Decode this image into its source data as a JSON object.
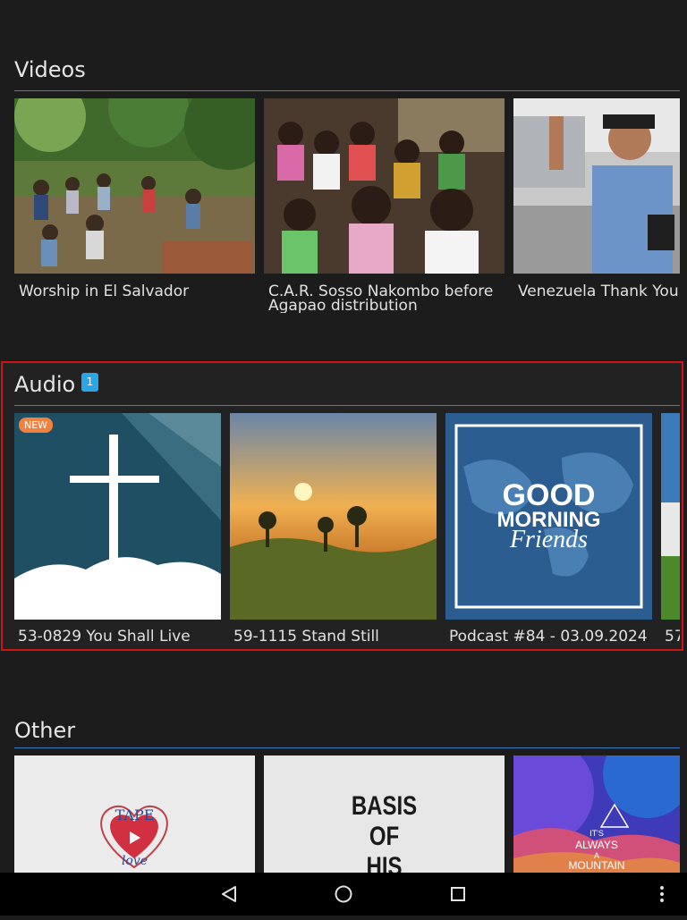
{
  "videos": {
    "title": "Videos",
    "items": [
      {
        "caption": "Worship in El Salvador"
      },
      {
        "caption": "C.A.R. Sosso Nakombo before Agapao distribution"
      },
      {
        "caption": "Venezuela Thank You"
      }
    ]
  },
  "audio": {
    "title": "Audio",
    "badge_count": "1",
    "items": [
      {
        "caption": "53-0829 You Shall Live",
        "tag": "NEW"
      },
      {
        "caption": "59-1115 Stand Still"
      },
      {
        "caption": "Podcast #84 - 03.09.2024",
        "art_line1": "GOOD",
        "art_line2": "MORNING",
        "art_line3": "Friends"
      },
      {
        "caption": "57"
      }
    ]
  },
  "other": {
    "title": "Other",
    "items": [
      {
        "art_line1": "TAPE",
        "art_line2": "love"
      },
      {
        "art_line1": "BASIS",
        "art_line2": "OF",
        "art_line3": "HIS"
      },
      {
        "art_line1": "IT'S",
        "art_line2": "ALWAYS",
        "art_line3": "A",
        "art_line4": "MOUNTAIN"
      }
    ]
  },
  "navbar": {
    "back_icon": "back-triangle-icon",
    "home_icon": "home-circle-icon",
    "recents_icon": "recents-square-icon",
    "menu_icon": "overflow-menu-icon"
  },
  "colors": {
    "accent_rule": "#3a7fc4",
    "badge": "#2aa6e8",
    "new_tag": "#f0813e",
    "highlight_border": "#d01414"
  }
}
